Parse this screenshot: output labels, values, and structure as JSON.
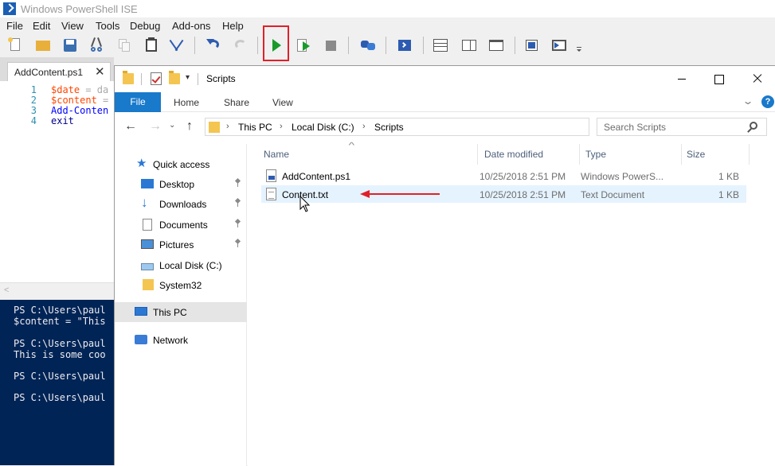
{
  "ise": {
    "title": "Windows PowerShell ISE",
    "menu": [
      "File",
      "Edit",
      "View",
      "Tools",
      "Debug",
      "Add-ons",
      "Help"
    ],
    "tab": {
      "label": "AddContent.ps1",
      "close": "✕"
    },
    "editor": {
      "lines": [
        {
          "num": "1",
          "var": "$date",
          "rest": " = da"
        },
        {
          "num": "2",
          "var": "$content",
          "rest": " ="
        },
        {
          "num": "3",
          "cmd": "Add-Conten"
        },
        {
          "num": "4",
          "key": "exit"
        }
      ]
    },
    "console": {
      "lines": [
        "PS C:\\Users\\paul",
        "$content = \"This",
        "",
        "PS C:\\Users\\paul",
        "This is some coo",
        "",
        "PS C:\\Users\\paul",
        "",
        "",
        "PS C:\\Users\\paul"
      ]
    }
  },
  "explorer": {
    "title": "Scripts",
    "ribbon": {
      "file": "File",
      "tabs": [
        "Home",
        "Share",
        "View"
      ],
      "help": "?"
    },
    "address": {
      "crumbs": [
        "This PC",
        "Local Disk (C:)",
        "Scripts"
      ]
    },
    "search": {
      "placeholder": "Search Scripts"
    },
    "nav": {
      "quick_access": "Quick access",
      "items": [
        "Desktop",
        "Downloads",
        "Documents",
        "Pictures",
        "Local Disk (C:)",
        "System32"
      ],
      "this_pc": "This PC",
      "network": "Network"
    },
    "columns": {
      "name": "Name",
      "date": "Date modified",
      "type": "Type",
      "size": "Size"
    },
    "files": [
      {
        "name": "AddContent.ps1",
        "date": "10/25/2018 2:51 PM",
        "type": "Windows PowerS...",
        "size": "1 KB"
      },
      {
        "name": "Content.txt",
        "date": "10/25/2018 2:51 PM",
        "type": "Text Document",
        "size": "1 KB"
      }
    ]
  },
  "colors": {
    "accent": "#1979ca",
    "console_bg": "#012456",
    "highlight": "#e0202a"
  }
}
